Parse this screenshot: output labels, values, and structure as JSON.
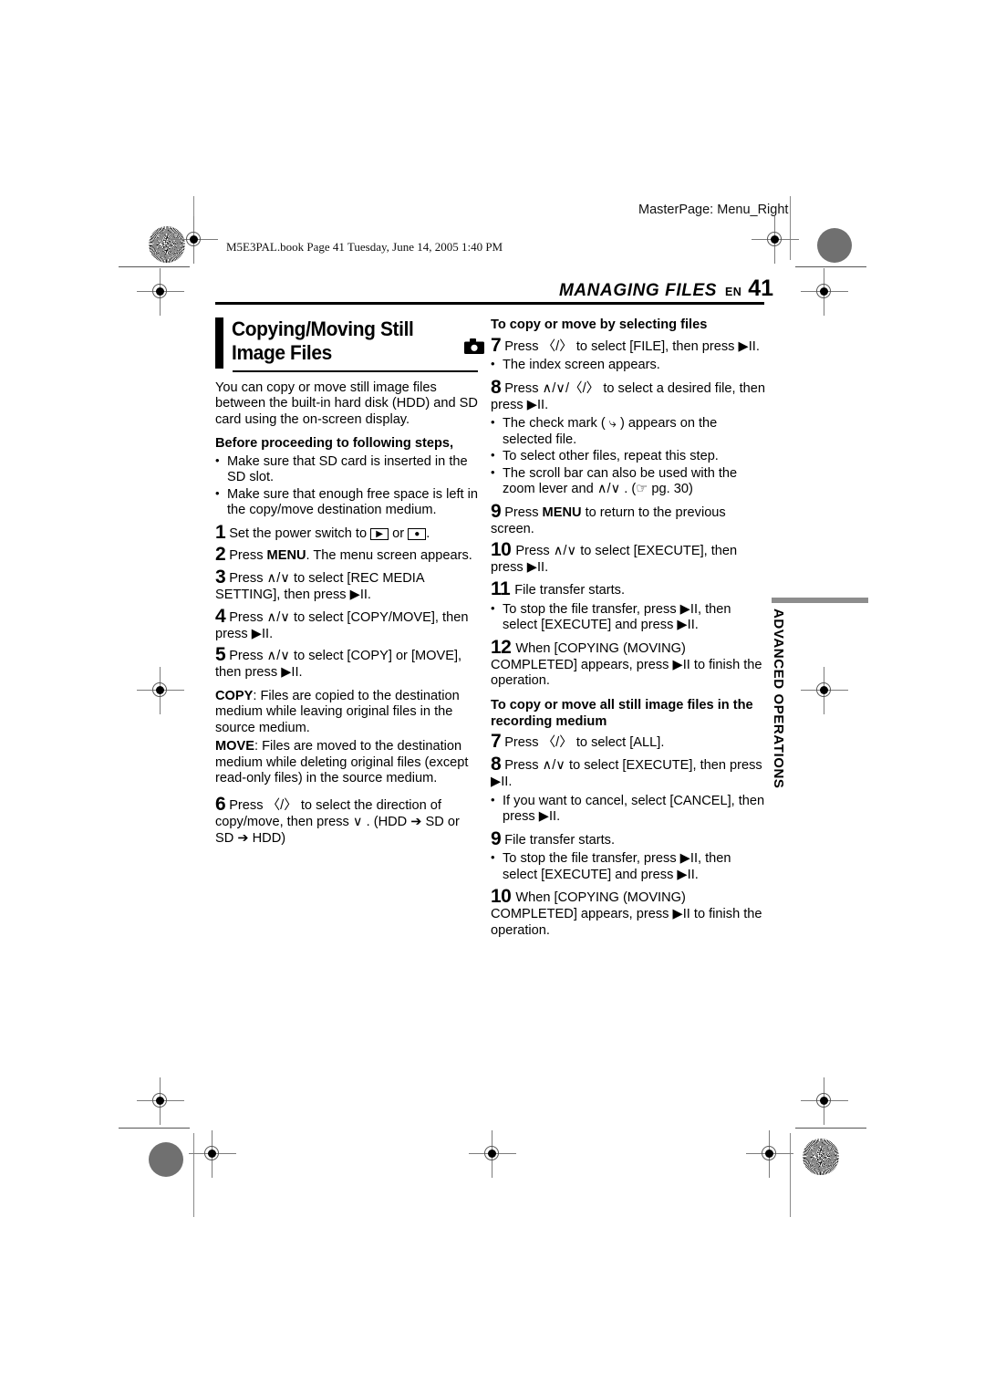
{
  "page": {
    "slug_line": "M5E3PAL.book  Page 41  Tuesday, June 14, 2005  1:40 PM",
    "masterpage": "MasterPage: Menu_Right",
    "running_head_title": "MANAGING FILES",
    "running_head_lang": "EN",
    "page_number": "41",
    "side_tab_label": "ADVANCED OPERATIONS"
  },
  "left_column": {
    "section_title": "Copying/Moving Still Image Files",
    "section_icon": "camera-icon",
    "intro": "You can copy or move still image files between the built-in hard disk (HDD) and SD card using the on-screen display.",
    "before_heading": "Before proceeding to following steps,",
    "before_bullets": [
      "Make sure that SD card is inserted in the SD slot.",
      "Make sure that enough free space is left in the copy/move destination medium."
    ],
    "steps": [
      {
        "num": "1",
        "pre": "Set the power switch to ",
        "icon1": "play-box-icon",
        "mid": " or ",
        "icon2": "record-box-icon",
        "post": "."
      },
      {
        "num": "2",
        "text_before": "Press ",
        "bold": "MENU",
        "text_after": ". The menu screen appears."
      },
      {
        "num": "3",
        "text": "Press ∧/∨ to select [REC MEDIA SETTING], then press ▶II."
      },
      {
        "num": "4",
        "text": "Press ∧/∨ to select [COPY/MOVE], then press ▶II."
      },
      {
        "num": "5",
        "text": "Press ∧/∨ to select [COPY] or [MOVE], then press ▶II."
      },
      {
        "num": "6",
        "text": "Press 〈/〉 to select the direction of copy/move, then press ∨ . (HDD ➔ SD or SD ➔ HDD)"
      }
    ],
    "copy_label": "COPY",
    "copy_text": ": Files are copied to the destination medium while leaving original files in the source medium.",
    "move_label": "MOVE",
    "move_text": ": Files are moved to the destination medium while deleting original files (except read-only files) in the source medium."
  },
  "right_column": {
    "heading_1": "To copy or move by selecting files",
    "section1_steps": [
      {
        "num": "7",
        "text": "Press 〈/〉 to select [FILE], then press ▶II."
      },
      {
        "num": "8",
        "text": "Press ∧/∨/〈/〉 to select a desired file, then press ▶II."
      },
      {
        "num": "9",
        "text_before": "Press ",
        "bold": "MENU",
        "text_after": " to return to the previous screen."
      },
      {
        "num": "10",
        "text": "Press ∧/∨ to select [EXECUTE], then press ▶II."
      },
      {
        "num": "11",
        "text": "File transfer starts."
      },
      {
        "num": "12",
        "text": "When [COPYING (MOVING) COMPLETED] appears, press ▶II to finish the operation."
      }
    ],
    "bullet_after_7": "The index screen appears.",
    "bullets_after_8": [
      "The check mark ( ⤷ ) appears on the selected file.",
      "To select other files, repeat this step.",
      "The scroll bar can also be used with the zoom lever and ∧/∨ . (☞ pg. 30)"
    ],
    "bullet_after_11": "To stop the file transfer, press ▶II, then select [EXECUTE] and press ▶II.",
    "heading_2": "To copy or move all still image files in the recording medium",
    "section2_steps": [
      {
        "num": "7",
        "text": "Press 〈/〉 to select [ALL]."
      },
      {
        "num": "8",
        "text": "Press ∧/∨ to select [EXECUTE], then press ▶II."
      },
      {
        "num": "9",
        "text": "File transfer starts."
      },
      {
        "num": "10",
        "text": "When [COPYING (MOVING) COMPLETED] appears, press ▶II to finish the operation."
      }
    ],
    "bullet_after_s2_8": "If you want to cancel, select [CANCEL], then press ▶II.",
    "bullet_after_s2_9": "To stop the file transfer, press ▶II, then select [EXECUTE] and press ▶II."
  }
}
